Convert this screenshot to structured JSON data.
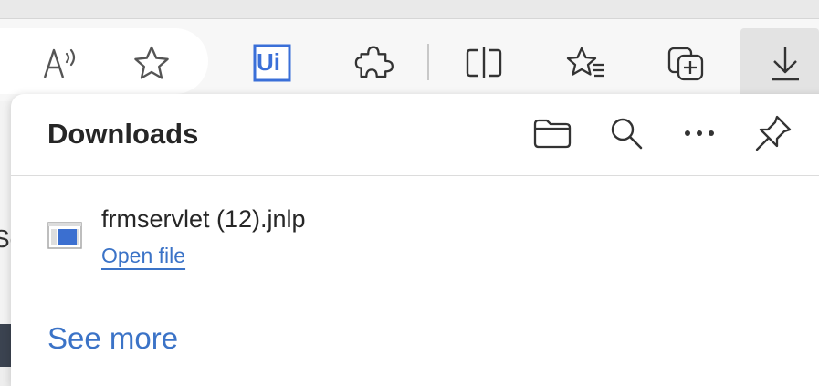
{
  "toolbar": {
    "read_aloud": "read-aloud",
    "favorite": "favorite-star",
    "uipath_label": "Ui",
    "extensions": "extensions",
    "split_screen": "split-screen",
    "favorites": "favorites-list",
    "collections": "collections",
    "downloads": "downloads"
  },
  "downloads": {
    "title": "Downloads",
    "items": [
      {
        "file_name": "frmservlet (12).jnlp",
        "action": "Open file"
      }
    ],
    "see_more": "See more"
  },
  "page": {
    "partial_text": "Se"
  },
  "colors": {
    "accent": "#3b73c7",
    "uipath_blue": "#3a6fd8"
  }
}
